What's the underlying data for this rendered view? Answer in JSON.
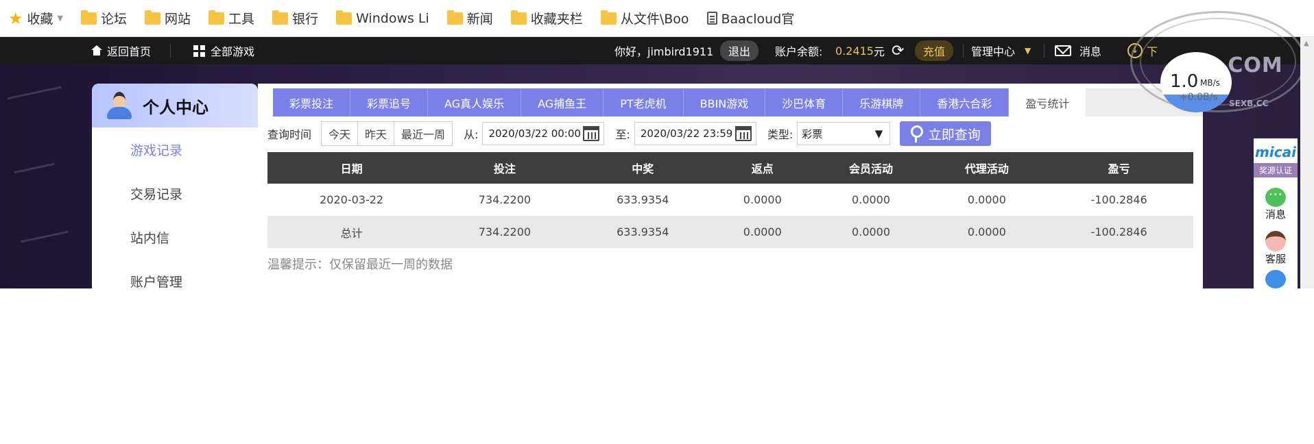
{
  "bookmarks": [
    {
      "label": "收藏",
      "icon": "star-icon",
      "has_dropdown": true
    },
    {
      "label": "论坛",
      "icon": "folder-icon"
    },
    {
      "label": "网站",
      "icon": "folder-icon"
    },
    {
      "label": "工具",
      "icon": "folder-icon"
    },
    {
      "label": "银行",
      "icon": "folder-icon"
    },
    {
      "label": "Windows Li",
      "icon": "folder-icon"
    },
    {
      "label": "新闻",
      "icon": "folder-icon"
    },
    {
      "label": "收藏夹栏",
      "icon": "folder-icon"
    },
    {
      "label": "从文件\\Boo",
      "icon": "folder-icon"
    },
    {
      "label": "Baacloud官",
      "icon": "document-icon"
    }
  ],
  "topbar": {
    "home": "返回首页",
    "all_games": "全部游戏",
    "greeting": "你好，jimbird1911",
    "logout": "退出",
    "balance_label": "账户余额:",
    "balance_value": "0.2415",
    "balance_unit": "元",
    "recharge": "充值",
    "admin_center": "管理中心",
    "messages": "消息",
    "download_partial": "下"
  },
  "sidebar": {
    "title": "个人中心",
    "items": [
      {
        "label": "游戏记录",
        "active": true
      },
      {
        "label": "交易记录",
        "active": false
      },
      {
        "label": "站内信",
        "active": false
      },
      {
        "label": "账户管理",
        "active": false
      }
    ]
  },
  "tabs": [
    {
      "label": "彩票投注",
      "active": false
    },
    {
      "label": "彩票追号",
      "active": false
    },
    {
      "label": "AG真人娱乐",
      "active": false
    },
    {
      "label": "AG捕鱼王",
      "active": false
    },
    {
      "label": "PT老虎机",
      "active": false
    },
    {
      "label": "BBIN游戏",
      "active": false
    },
    {
      "label": "沙巴体育",
      "active": false
    },
    {
      "label": "乐游棋牌",
      "active": false
    },
    {
      "label": "香港六合彩",
      "active": false
    },
    {
      "label": "盈亏统计",
      "active": true
    }
  ],
  "query": {
    "label": "查询时间",
    "quick": [
      "今天",
      "昨天",
      "最近一周"
    ],
    "from_label": "从:",
    "from_value": "2020/03/22 00:00",
    "to_label": "至:",
    "to_value": "2020/03/22 23:59",
    "type_label": "类型:",
    "type_value": "彩票",
    "search_button": "立即查询"
  },
  "table": {
    "headers": [
      "日期",
      "投注",
      "中奖",
      "返点",
      "会员活动",
      "代理活动",
      "盈亏"
    ],
    "rows": [
      [
        "2020-03-22",
        "734.2200",
        "633.9354",
        "0.0000",
        "0.0000",
        "0.0000",
        "-100.2846"
      ],
      [
        "总计",
        "734.2200",
        "633.9354",
        "0.0000",
        "0.0000",
        "0.0000",
        "-100.2846"
      ]
    ]
  },
  "hint": "温馨提示：仅保留最近一周的数据",
  "speed_widget": {
    "value": "1.0",
    "unit": "MB/s",
    "upload": "+0.0B/s"
  },
  "watermark": {
    "text": ".COM",
    "subtext": "SEXB.CC"
  },
  "right_rail": {
    "brand": "micai",
    "cert": "奖源认证",
    "items": [
      "消息",
      "客服"
    ]
  },
  "colors": {
    "accent": "#7b80e8",
    "topbar": "#1a1a1a",
    "gold": "#e8c25e",
    "table_header": "#3d3d3d"
  }
}
